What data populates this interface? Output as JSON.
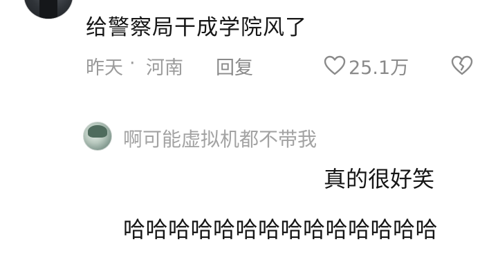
{
  "comment": {
    "text": "给警察局干成学院风了",
    "time": "昨天",
    "separator": "·",
    "location": "河南",
    "reply_label": "回复",
    "like_count": "25.1万",
    "like_icon": "heart-icon",
    "dislike_icon": "broken-heart-icon"
  },
  "reply": {
    "username": "啊可能虚拟机都不带我",
    "line1": "真的很好笑",
    "line2": "哈哈哈哈哈哈哈哈哈哈哈哈哈哈"
  },
  "colors": {
    "text_primary": "#161616",
    "text_secondary": "#9b9b9b",
    "background": "#ffffff"
  }
}
